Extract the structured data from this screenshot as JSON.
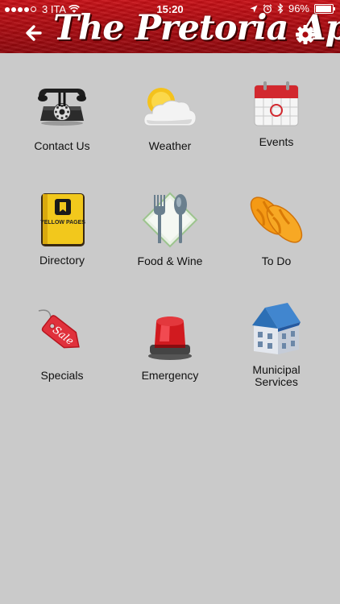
{
  "status_bar": {
    "carrier": "3 ITA",
    "time": "15:20",
    "battery": "96%",
    "battery_level": 0.96
  },
  "header": {
    "title": "The Pretoria App",
    "back_icon": "back-arrow-icon",
    "settings_icon": "gear-icon"
  },
  "menu": {
    "items": [
      {
        "label": "Contact Us",
        "icon": "telephone-icon"
      },
      {
        "label": "Weather",
        "icon": "weather-icon"
      },
      {
        "label": "Events",
        "icon": "calendar-icon"
      },
      {
        "label": "Directory",
        "icon": "yellow-pages-icon"
      },
      {
        "label": "Food & Wine",
        "icon": "cutlery-icon"
      },
      {
        "label": "To Do",
        "icon": "flip-flops-icon"
      },
      {
        "label": "Specials",
        "icon": "sale-tag-icon"
      },
      {
        "label": "Emergency",
        "icon": "siren-icon"
      },
      {
        "label": "Municipal Services",
        "icon": "building-icon"
      }
    ]
  },
  "icon_text": {
    "directory": "YELLOW PAGES",
    "specials": "Sale"
  },
  "colors": {
    "header_red": "#b00c12",
    "background": "#cacaca",
    "label_text": "#111111"
  }
}
